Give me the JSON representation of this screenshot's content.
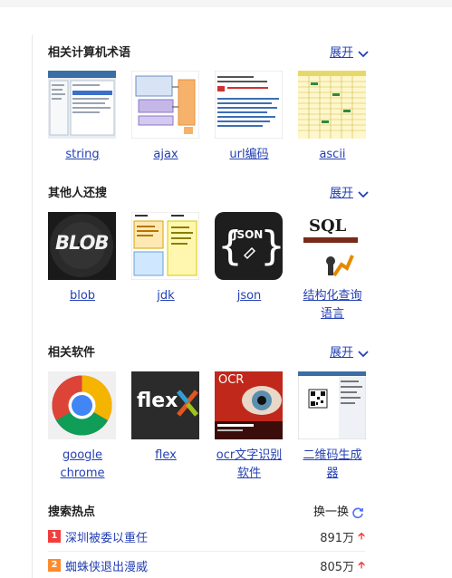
{
  "sections": [
    {
      "title": "相关计算机术语",
      "expand_label": "展开",
      "items": [
        {
          "caption": "string"
        },
        {
          "caption": "ajax"
        },
        {
          "caption": "url编码"
        },
        {
          "caption": "ascii"
        }
      ]
    },
    {
      "title": "其他人还搜",
      "expand_label": "展开",
      "items": [
        {
          "caption": "blob",
          "thumb_text": "BLOB"
        },
        {
          "caption": "jdk"
        },
        {
          "caption": "json",
          "thumb_text": "JSON"
        },
        {
          "caption": "结构化查询语言",
          "thumb_text": "SQL"
        }
      ]
    },
    {
      "title": "相关软件",
      "expand_label": "展开",
      "items": [
        {
          "caption": "google chrome"
        },
        {
          "caption": "flex",
          "thumb_text": "flex"
        },
        {
          "caption": "ocr文字识别软件",
          "thumb_text": "OCR"
        },
        {
          "caption": "二维码生成器"
        }
      ]
    }
  ],
  "hot": {
    "title": "搜索热点",
    "refresh_label": "换一换",
    "items": [
      {
        "rank": "1",
        "text": "深圳被委以重任",
        "count": "891万",
        "rank_color": "#f23d3d"
      },
      {
        "rank": "2",
        "text": "蜘蛛侠退出漫威",
        "count": "805万",
        "rank_color": "#ff8a2b"
      }
    ]
  },
  "colors": {
    "link": "#2440b3",
    "hot_red": "#f23d3d",
    "hot_orange": "#ff8a2b"
  }
}
